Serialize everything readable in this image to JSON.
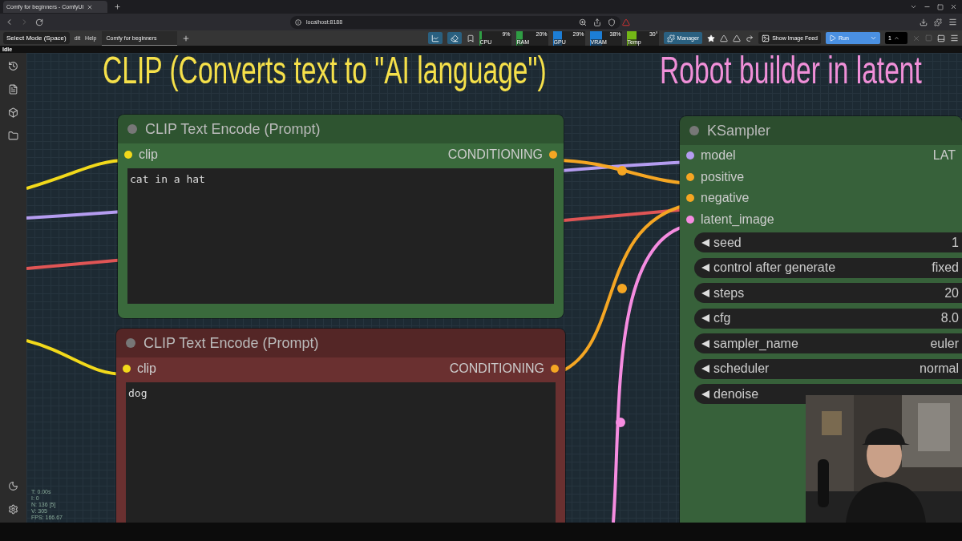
{
  "browser": {
    "tab_title": "Comfy for beginners - ComfyUI",
    "address": "localhost:8188"
  },
  "menubar": {
    "items": [
      {
        "label": "Select Mode (Space)",
        "kind": "tooltip"
      },
      {
        "label": "dit",
        "kind": "menu"
      },
      {
        "label": "Help",
        "kind": "menu"
      }
    ],
    "workflow_tabs": [
      {
        "label": "Comfy for beginners",
        "selected": true
      }
    ],
    "monitors": [
      {
        "label": "CPU",
        "reading": "9%",
        "level": 0.09,
        "color": "#2f9e44"
      },
      {
        "label": "RAM",
        "reading": "20%",
        "level": 0.2,
        "color": "#2f9e44"
      },
      {
        "label": "GPU",
        "reading": "29%",
        "level": 0.29,
        "color": "#1c7ed6"
      },
      {
        "label": "VRAM",
        "reading": "38%",
        "level": 0.38,
        "color": "#1c7ed6"
      },
      {
        "label": "Temp",
        "reading": "30°",
        "level": 0.3,
        "color": "#74b816"
      }
    ],
    "manager": "Manager",
    "image_feed": "Show Image Feed",
    "run": "Run",
    "batch_count": "1"
  },
  "status": "Idle",
  "captions": [
    {
      "text": "CLIP (Converts text to \"AI language\")",
      "color": "#f5e04a"
    },
    {
      "text": "Robot builder in latent",
      "color": "#f08fd8"
    }
  ],
  "nodes": [
    {
      "title": "CLIP Text Encode (Prompt)",
      "color": "#3a6a3c",
      "inputs": [
        {
          "name": "clip",
          "color": "#f2d91b"
        }
      ],
      "output": {
        "name": "CONDITIONING",
        "color": "#f5a623"
      },
      "text": "cat in a hat"
    },
    {
      "title": "CLIP Text Encode (Prompt)",
      "color": "#6a3030",
      "inputs": [
        {
          "name": "clip",
          "color": "#f2d91b"
        }
      ],
      "output": {
        "name": "CONDITIONING",
        "color": "#f5a623"
      },
      "text": "dog"
    },
    {
      "title": "KSampler",
      "color": "#37613a",
      "inputs": [
        {
          "name": "model",
          "color": "#b49cf0"
        },
        {
          "name": "positive",
          "color": "#f5a623"
        },
        {
          "name": "negative",
          "color": "#f5a623"
        },
        {
          "name": "latent_image",
          "color": "#f58ce0"
        }
      ],
      "output": {
        "name": "LAT"
      },
      "widgets": [
        {
          "name": "seed",
          "value": "1"
        },
        {
          "name": "control after generate",
          "value": "fixed"
        },
        {
          "name": "steps",
          "value": "20"
        },
        {
          "name": "cfg",
          "value": "8.0"
        },
        {
          "name": "sampler_name",
          "value": "euler"
        },
        {
          "name": "scheduler",
          "value": "normal"
        },
        {
          "name": "denoise"
        }
      ]
    }
  ],
  "stats": [
    "T: 0.00s",
    "I: 0",
    "N: 136 [5]",
    "V: 305",
    "FPS: 166.67"
  ]
}
